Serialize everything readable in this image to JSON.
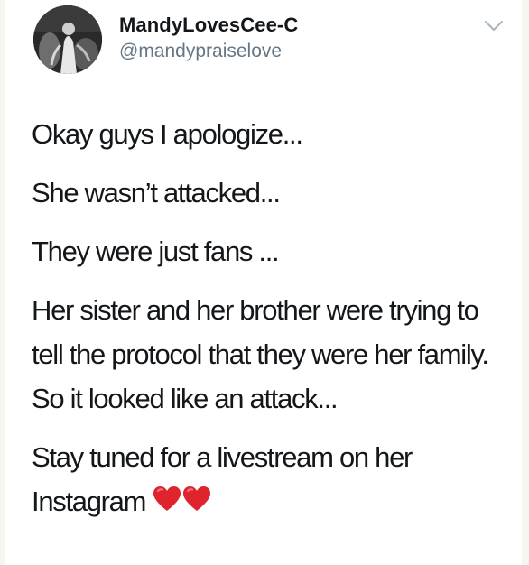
{
  "user": {
    "display_name": "MandyLovesCee-C",
    "handle": "@mandypraiselove",
    "avatar_icon": "profile-photo"
  },
  "menu": {
    "icon": "chevron-down-icon"
  },
  "tweet": {
    "paragraphs": [
      "Okay guys I apologize...",
      "She wasn’t attacked...",
      "They were just fans ...",
      "Her sister and her brother were trying to tell the protocol that they were her family. So it looked like an attack...",
      "Stay tuned for a livestream on her Instagram"
    ],
    "trailing_emoji": [
      "red-heart-icon",
      "red-heart-icon"
    ]
  },
  "colors": {
    "page_background": "#f4f7ee",
    "text_primary": "#14171a",
    "text_secondary": "#657786",
    "heart": "#e0242e"
  }
}
